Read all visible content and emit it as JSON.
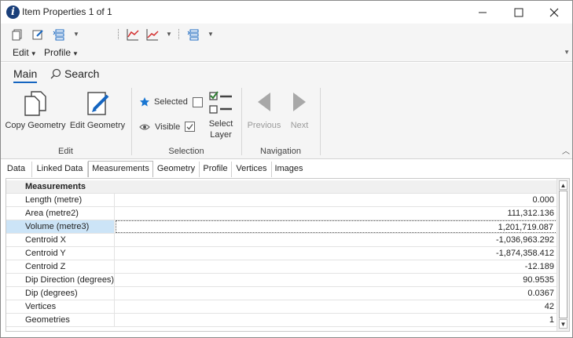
{
  "window": {
    "title": "Item Properties 1 of 1",
    "app_icon": "info-icon",
    "controls": [
      "minimize-icon",
      "maximize-icon",
      "close-icon"
    ]
  },
  "quick_access": {
    "icons": [
      "copy-geometry-icon",
      "edit-geometry-icon",
      "select-layer-icon",
      "line-chart-icon",
      "line-chart-icon",
      "select-layer-icon"
    ]
  },
  "menu": {
    "edit_label": "Edit",
    "profile_label": "Profile"
  },
  "ribbon": {
    "tabs": {
      "main": "Main",
      "search": "Search"
    },
    "buttons": {
      "copy_geometry": "Copy Geometry",
      "edit_geometry": "Edit Geometry",
      "select_layer_line1": "Select",
      "select_layer_line2": "Layer",
      "previous": "Previous",
      "next": "Next"
    },
    "selection": {
      "selected_label": "Selected",
      "selected_checked": false,
      "visible_label": "Visible",
      "visible_checked": true
    },
    "groups": {
      "edit": "Edit",
      "selection": "Selection",
      "navigation": "Navigation"
    }
  },
  "tabs": [
    "Data",
    "Linked Data",
    "Measurements",
    "Geometry",
    "Profile",
    "Vertices",
    "Images"
  ],
  "active_tab": "Measurements",
  "grid": {
    "header": "Measurements",
    "rows": [
      {
        "name": "Length (metre)",
        "value": "0.000"
      },
      {
        "name": "Area (metre2)",
        "value": "111,312.136"
      },
      {
        "name": "Volume (metre3)",
        "value": "1,201,719.087"
      },
      {
        "name": "Centroid X",
        "value": "-1,036,963.292"
      },
      {
        "name": "Centroid Y",
        "value": "-1,874,358.412"
      },
      {
        "name": "Centroid Z",
        "value": "-12.189"
      },
      {
        "name": "Dip Direction (degrees)",
        "value": "90.9535"
      },
      {
        "name": "Dip (degrees)",
        "value": "0.0367"
      },
      {
        "name": "Vertices",
        "value": "42"
      },
      {
        "name": "Geometries",
        "value": "1"
      }
    ],
    "selected_row": "Volume (metre3)"
  },
  "colors": {
    "accent": "#1565c0",
    "selection": "#cce4f7",
    "ribbon_bg": "#f5f5f5"
  }
}
